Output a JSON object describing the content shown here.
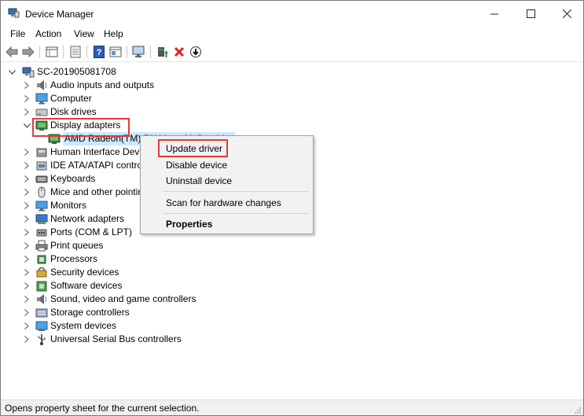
{
  "window": {
    "title": "Device Manager"
  },
  "menu": [
    "File",
    "Action",
    "View",
    "Help"
  ],
  "toolbar": [
    "back-icon",
    "forward-icon",
    "properties-icon",
    "show-hidden-icon",
    "help-icon",
    "view-icon",
    "monitor-icon",
    "update-driver-icon",
    "uninstall-icon",
    "download-icon"
  ],
  "tree": {
    "root": "SC-201905081708",
    "categories": [
      {
        "label": "Audio inputs and outputs",
        "icon": "speaker-icon"
      },
      {
        "label": "Computer",
        "icon": "computer-icon"
      },
      {
        "label": "Disk drives",
        "icon": "disk-icon"
      },
      {
        "label": "Display adapters",
        "icon": "display-adapter-icon",
        "expanded": true
      },
      {
        "label": "AMD Radeon(TM) RX Vega 11 Graphics",
        "icon": "display-adapter-icon",
        "child": true
      },
      {
        "label": "Human Interface Devices",
        "icon": "hid-icon"
      },
      {
        "label": "IDE ATA/ATAPI controllers",
        "icon": "ide-icon"
      },
      {
        "label": "Keyboards",
        "icon": "keyboard-icon"
      },
      {
        "label": "Mice and other pointing devices",
        "icon": "mouse-icon"
      },
      {
        "label": "Monitors",
        "icon": "monitor-icon"
      },
      {
        "label": "Network adapters",
        "icon": "network-icon"
      },
      {
        "label": "Ports (COM & LPT)",
        "icon": "port-icon"
      },
      {
        "label": "Print queues",
        "icon": "printer-icon"
      },
      {
        "label": "Processors",
        "icon": "processor-icon"
      },
      {
        "label": "Security devices",
        "icon": "security-icon"
      },
      {
        "label": "Software devices",
        "icon": "software-icon"
      },
      {
        "label": "Sound, video and game controllers",
        "icon": "sound-icon"
      },
      {
        "label": "Storage controllers",
        "icon": "storage-icon"
      },
      {
        "label": "System devices",
        "icon": "system-icon"
      },
      {
        "label": "Universal Serial Bus controllers",
        "icon": "usb-icon"
      }
    ]
  },
  "context_menu": {
    "update_driver": "Update driver",
    "disable_device": "Disable device",
    "uninstall_device": "Uninstall device",
    "scan": "Scan for hardware changes",
    "properties": "Properties"
  },
  "status": "Opens property sheet for the current selection.",
  "colors": {
    "highlight": "#e03a3a",
    "selection": "#cce8ff"
  }
}
